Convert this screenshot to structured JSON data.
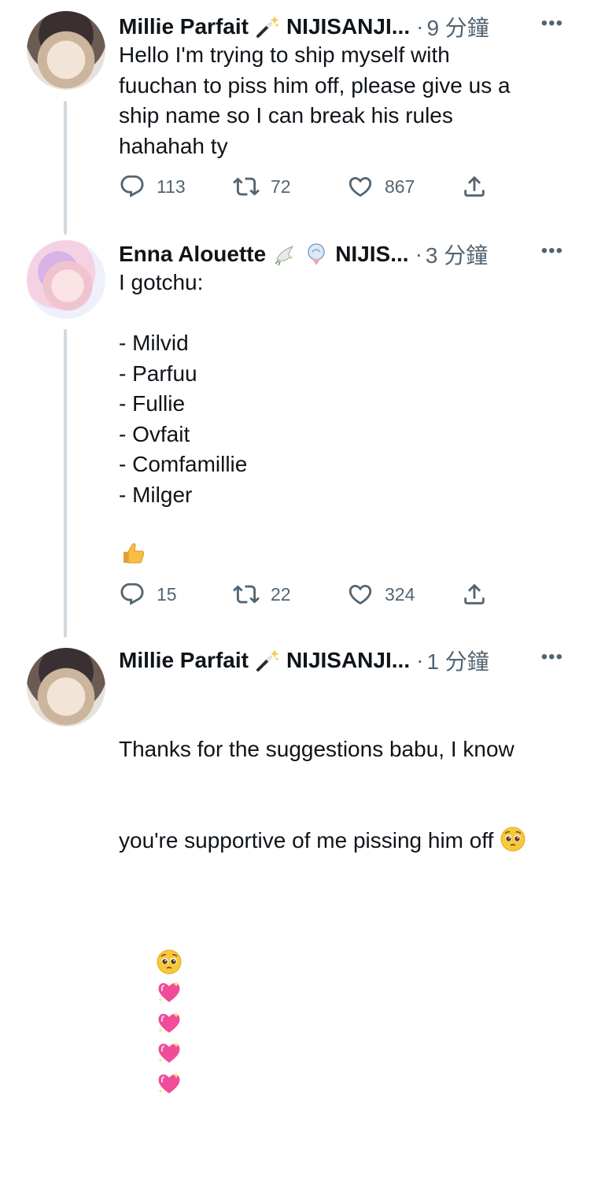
{
  "tweets": [
    {
      "author": "Millie Parfait",
      "author_emoji": "magic-wand",
      "org": "NIJISANJI...",
      "separator": "·",
      "time": "9 分鐘",
      "text": "Hello I'm trying to ship myself with\nfuuchan to piss him off, please give us a\nship name so I can break his rules\nhahahah ty",
      "replies": "113",
      "retweets": "72",
      "likes": "867"
    },
    {
      "author": "Enna Alouette",
      "author_emoji": "dove",
      "author_emoji2": "ice-cream",
      "org": "NIJIS...",
      "separator": "·",
      "time": "3 分鐘",
      "text": "I gotchu:\n\n- Milvid\n- Parfuu\n- Fullie\n- Ovfait\n- Comfamillie\n- Milger",
      "text_emoji": "thumbs-up",
      "replies": "15",
      "retweets": "22",
      "likes": "324"
    },
    {
      "author": "Millie Parfait",
      "author_emoji": "magic-wand",
      "org": "NIJISANJI...",
      "separator": "·",
      "time": "1 分鐘",
      "text_line1": "Thanks for the suggestions babu, I know",
      "text_line2": "you're supportive of me pissing him off",
      "text_emojis": [
        "pleading-face",
        "pleading-face",
        "sparkling-heart",
        "sparkling-heart",
        "sparkling-heart",
        "sparkling-heart"
      ]
    }
  ],
  "more_label": "•••"
}
